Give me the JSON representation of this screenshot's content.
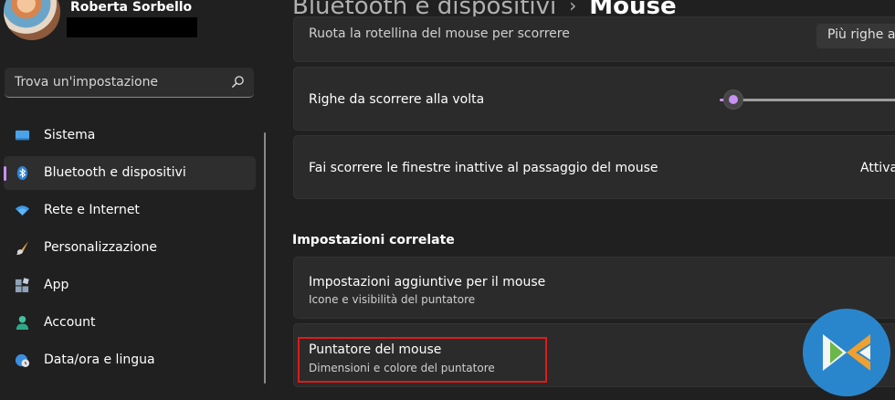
{
  "user": {
    "name": "Roberta Sorbello"
  },
  "search": {
    "placeholder": "Trova un'impostazione",
    "icon": "search-icon"
  },
  "sidebar": {
    "items": [
      {
        "label": "Sistema",
        "icon": "monitor-icon",
        "selected": false
      },
      {
        "label": "Bluetooth e dispositivi",
        "icon": "bluetooth-icon",
        "selected": true
      },
      {
        "label": "Rete e Internet",
        "icon": "wifi-icon",
        "selected": false
      },
      {
        "label": "Personalizzazione",
        "icon": "brush-icon",
        "selected": false
      },
      {
        "label": "App",
        "icon": "apps-icon",
        "selected": false
      },
      {
        "label": "Account",
        "icon": "person-icon",
        "selected": false
      },
      {
        "label": "Data/ora e lingua",
        "icon": "globe-clock-icon",
        "selected": false
      }
    ]
  },
  "header": {
    "parent": "Bluetooth e dispositivi",
    "separator": "›",
    "current": "Mouse"
  },
  "settings": {
    "scroll_wheel": {
      "label": "Ruota la rotellina del mouse per scorrere",
      "value": "Più righe alla"
    },
    "lines_to_scroll": {
      "label": "Righe da scorrere alla volta",
      "level_fraction": 0.02
    },
    "inactive_scroll": {
      "label": "Fai scorrere le finestre inattive al passaggio del mouse",
      "state": "Attivato"
    }
  },
  "related": {
    "heading": "Impostazioni correlate",
    "items": [
      {
        "title": "Impostazioni aggiuntive per il mouse",
        "subtitle": "Icone e visibilità del puntatore"
      },
      {
        "title": "Puntatore del mouse",
        "subtitle": "Dimensioni e colore del puntatore"
      }
    ]
  },
  "colors": {
    "background": "#202020",
    "card": "#2b2b2b",
    "accent": "#c792f0",
    "highlight": "#e01a1a"
  }
}
